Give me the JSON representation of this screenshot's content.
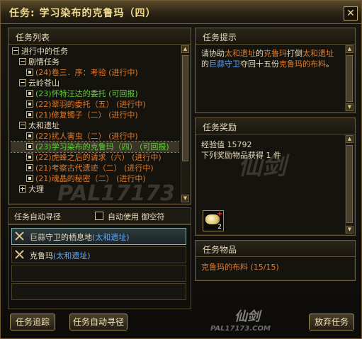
{
  "window": {
    "title": "任务: 学习染布的克鲁玛（四）"
  },
  "quest_list": {
    "title": "任务列表",
    "rows": [
      {
        "text": "进行中的任务",
        "color": "white",
        "box": "minus",
        "indent": 0
      },
      {
        "text": "剧情任务",
        "color": "white",
        "box": "minus",
        "indent": 1
      },
      {
        "text": "(24)卷三．序：考验 (进行中)",
        "color": "orange",
        "box": "filled",
        "indent": 2
      },
      {
        "text": "云岭苍山",
        "color": "white",
        "box": "minus",
        "indent": 1
      },
      {
        "text": "(23)怀特汪达的委托 (可回报)",
        "color": "green",
        "box": "filled",
        "indent": 2
      },
      {
        "text": "(22)翠羽的委托（五） (进行中)",
        "color": "orange",
        "box": "filled",
        "indent": 2
      },
      {
        "text": "(21)修复镯子（二） (进行中)",
        "color": "orange",
        "box": "filled",
        "indent": 2
      },
      {
        "text": "太和遗址",
        "color": "white",
        "box": "minus",
        "indent": 1
      },
      {
        "text": "(22)扰人害虫（二） (进行中)",
        "color": "orange",
        "box": "filled",
        "indent": 2
      },
      {
        "text": "(23)学习染布的克鲁玛（四） (可回报)",
        "color": "green",
        "box": "filled",
        "indent": 2,
        "selected": true
      },
      {
        "text": "(22)虎蜂之后的请求（六） (进行中)",
        "color": "orange",
        "box": "filled",
        "indent": 2
      },
      {
        "text": "(21)考察古代遗迹（二） (进行中)",
        "color": "orange",
        "box": "filled",
        "indent": 2
      },
      {
        "text": "(21)魂晶的秘密（二） (进行中)",
        "color": "orange",
        "box": "filled",
        "indent": 2
      },
      {
        "text": "大理",
        "color": "white",
        "box": "plus",
        "indent": 1
      }
    ]
  },
  "auto_path": {
    "title": "任务自动寻径",
    "checkbox_label": "自动使用  御空符",
    "items": [
      {
        "name": "巨蒜守卫的栖息地",
        "place": "(太和遗址)",
        "active": true
      },
      {
        "name": "克鲁玛",
        "place": "(太和遗址)",
        "active": false
      }
    ]
  },
  "buttons": {
    "track": "任务追踪",
    "auto_path": "任务自动寻径",
    "abandon": "放弃任务"
  },
  "hint": {
    "title": "任务提示",
    "parts": [
      {
        "t": "请协助",
        "c": "white"
      },
      {
        "t": "太和遗址",
        "c": "orange"
      },
      {
        "t": "的",
        "c": "white"
      },
      {
        "t": "克鲁玛",
        "c": "orange"
      },
      {
        "t": "打倒",
        "c": "white"
      },
      {
        "t": "太和遗址",
        "c": "orange"
      },
      {
        "t": "的",
        "c": "white"
      },
      {
        "t": "巨蒜守卫",
        "c": "blue"
      },
      {
        "t": "夺回十五份",
        "c": "white"
      },
      {
        "t": "克鲁玛的布料",
        "c": "orange"
      },
      {
        "t": "。",
        "c": "white"
      }
    ]
  },
  "reward": {
    "title": "任务奖励",
    "exp_line": "经验值 15792",
    "items_line": "下列奖励物品获得 1 件",
    "slot_count": "2"
  },
  "items": {
    "title": "任务物品",
    "entry": "克鲁玛的布料 (15/15)"
  },
  "watermark": {
    "a": "PAL17173",
    "b": "仙剑",
    "c": "PAL17173.COM"
  }
}
